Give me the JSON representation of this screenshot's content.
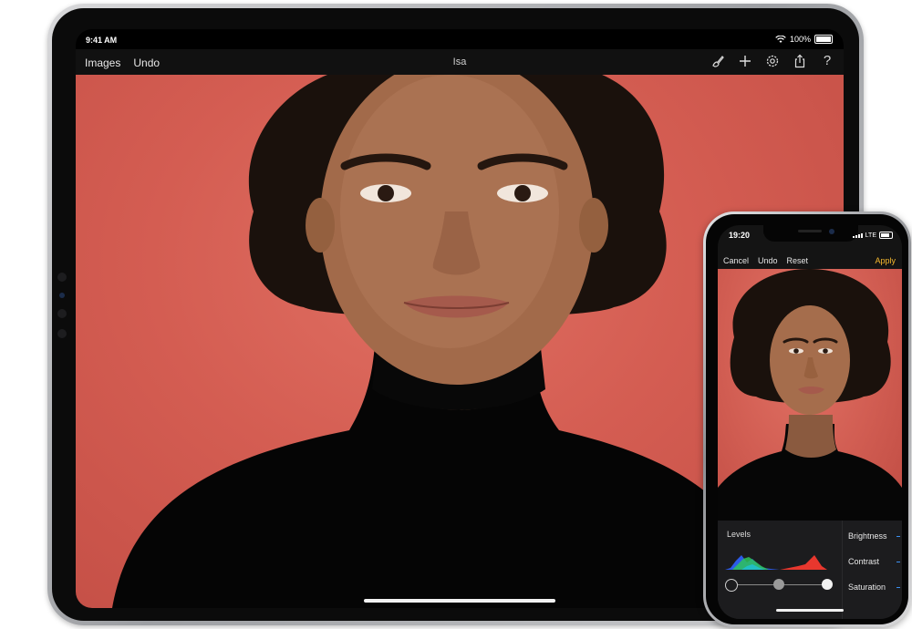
{
  "ipad": {
    "status": {
      "time": "9:41 AM",
      "battery": "100%"
    },
    "toolbar": {
      "left_items": [
        {
          "label": "Images"
        },
        {
          "label": "Undo"
        }
      ],
      "title": "Isa",
      "right_icons": [
        "brush-icon",
        "plus-icon",
        "gear-icon",
        "share-icon",
        "help-icon"
      ],
      "help_glyph": "?"
    }
  },
  "iphone": {
    "status": {
      "time": "19:20",
      "network": "LTE"
    },
    "toolbar": {
      "cancel": "Cancel",
      "undo": "Undo",
      "reset": "Reset",
      "apply": "Apply"
    },
    "panel": {
      "levels_label": "Levels",
      "adjustments": [
        {
          "label": "Brightness"
        },
        {
          "label": "Contrast"
        },
        {
          "label": "Saturation"
        }
      ]
    }
  },
  "colors": {
    "accent": "#f5b82e",
    "photo_background": "#d45d52",
    "indicator": "#3b8ff0"
  }
}
